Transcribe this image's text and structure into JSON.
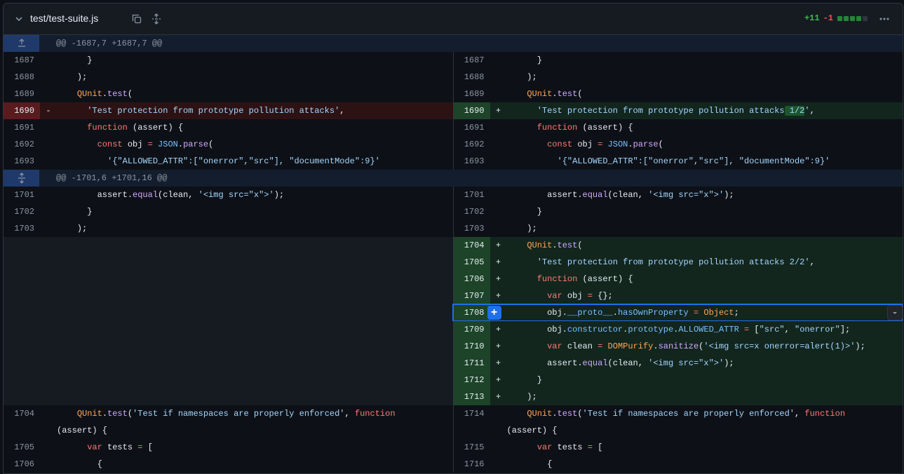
{
  "file": {
    "name": "test/test-suite.js",
    "additions": "+11",
    "deletions": "-1"
  },
  "icons": {
    "collapse": "chevron-down-icon",
    "copy": "copy-icon",
    "expand": "unfold-icon",
    "more": "kebab-horizontal-icon",
    "expand_up": "fold-up-icon",
    "expand_both": "unfold-icon",
    "add_comment": "plus-icon",
    "dropdown": "triangle-down-icon"
  },
  "hunks": [
    {
      "header": "@@ -1687,7 +1687,7 @@"
    },
    {
      "header": "@@ -1701,6 +1701,16 @@"
    }
  ],
  "lines": {
    "l1687": "1687",
    "l1688": "1688",
    "l1689": "1689",
    "l1690": "1690",
    "l1691": "1691",
    "l1692": "1692",
    "l1693": "1693",
    "l1701": "1701",
    "l1702": "1702",
    "l1703": "1703",
    "l1704": "1704",
    "l1705": "1705",
    "l1706": "1706",
    "l1707": "1707",
    "l1708": "1708",
    "l1709": "1709",
    "l1710": "1710",
    "l1711": "1711",
    "l1712": "1712",
    "l1713": "1713",
    "l1714": "1714",
    "l1715": "1715",
    "l1716": "1716"
  },
  "signs": {
    "minus": "-",
    "plus": "+"
  }
}
